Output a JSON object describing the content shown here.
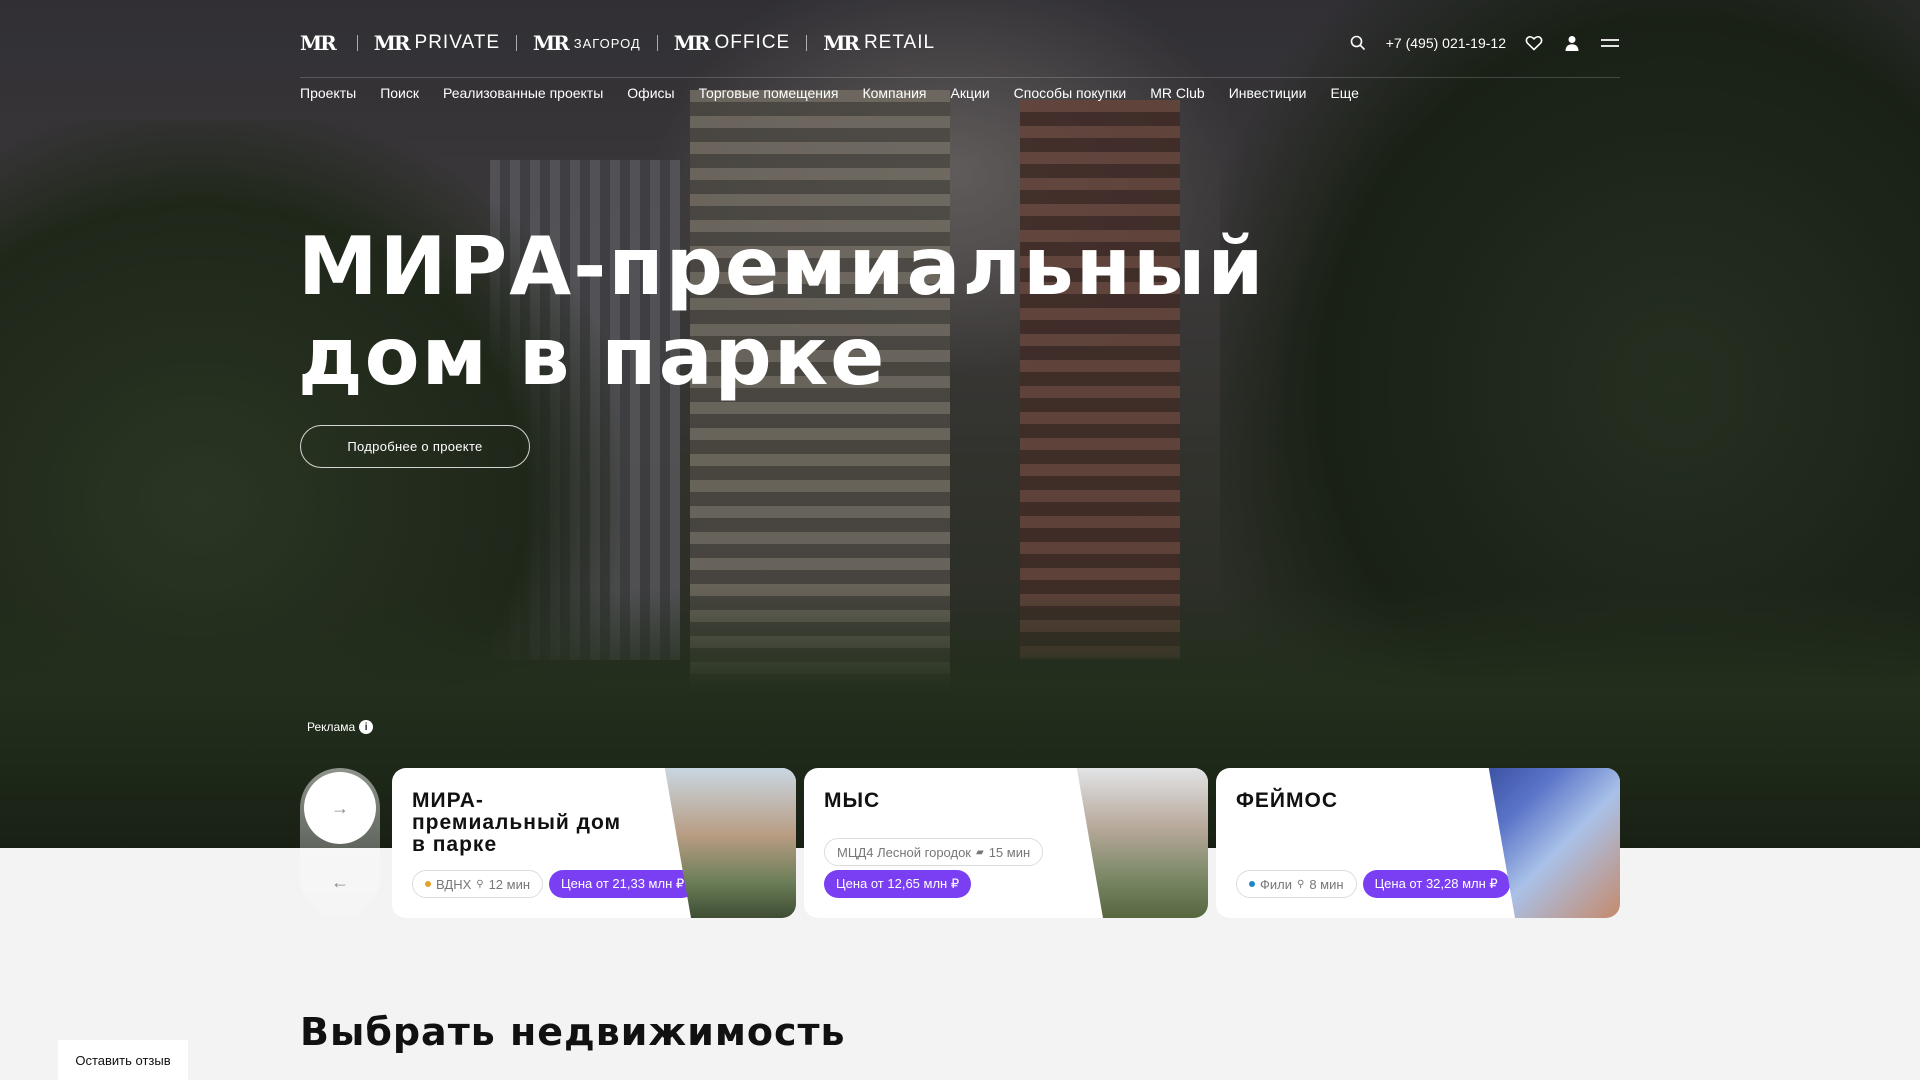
{
  "header": {
    "brands": [
      {
        "mark": "MR",
        "name": ""
      },
      {
        "mark": "MR",
        "name": "PRIVATE"
      },
      {
        "mark": "MR",
        "name": "ЗАГОРОД"
      },
      {
        "mark": "MR",
        "name": "OFFICE"
      },
      {
        "mark": "MR",
        "name": "RETAIL"
      }
    ],
    "phone": "+7 (495) 021-19-12"
  },
  "nav": {
    "items": [
      "Проекты",
      "Поиск",
      "Реализованные проекты",
      "Офисы",
      "Торговые помещения",
      "Компания",
      "Акции",
      "Способы покупки",
      "MR Club",
      "Инвестиции",
      "Еще"
    ]
  },
  "hero": {
    "headline_line1": "МИРА-премиальный",
    "headline_line2": "дом в парке",
    "button": "Подробнее о проекте",
    "ad_label": "Реклама",
    "ad_info": "i"
  },
  "slider": {
    "next": "→",
    "prev": "←"
  },
  "cards": [
    {
      "title": "МИРА-премиальный дом в парке",
      "station": "ВДНХ",
      "station_color": "#e3a32a",
      "travel": "12 мин",
      "price": "Цена от 21,33 млн ₽"
    },
    {
      "title": "МЫС",
      "station": "МЦД4 Лесной городок",
      "travel": "15 мин",
      "price": "Цена от 12,65 млн ₽"
    },
    {
      "title": "ФЕЙМОС",
      "station": "Фили",
      "station_color": "#1d88c9",
      "travel": "8 мин",
      "price": "Цена от 32,28 млн ₽"
    }
  ],
  "section": {
    "title": "Выбрать недвижимость"
  },
  "feedback": "Оставить отзыв",
  "colors": {
    "accent": "#7a3ff2"
  }
}
